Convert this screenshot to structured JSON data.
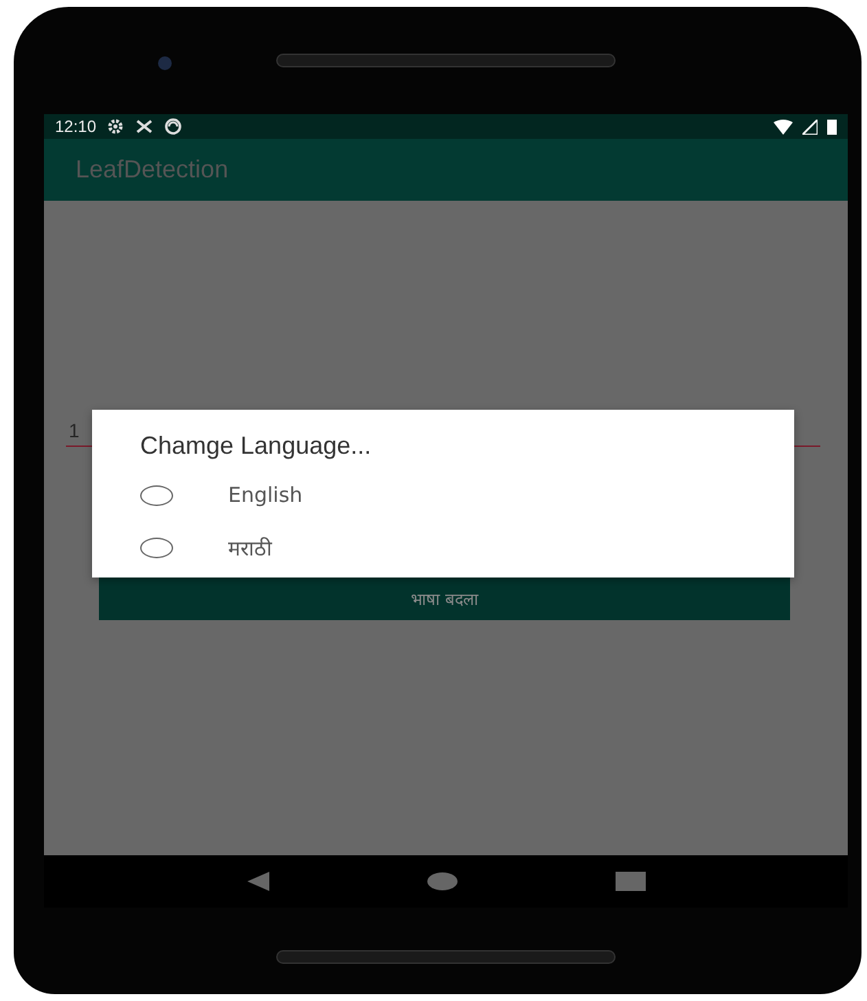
{
  "status_bar": {
    "time": "12:10"
  },
  "app_bar": {
    "title": "LeafDetection"
  },
  "content": {
    "field": {
      "value": "1"
    },
    "button": {
      "label": "भाषा बदला"
    }
  },
  "dialog": {
    "title": "Chamge Language...",
    "options": [
      {
        "label": "English",
        "selected": false
      },
      {
        "label": "मराठी",
        "selected": false
      }
    ]
  }
}
